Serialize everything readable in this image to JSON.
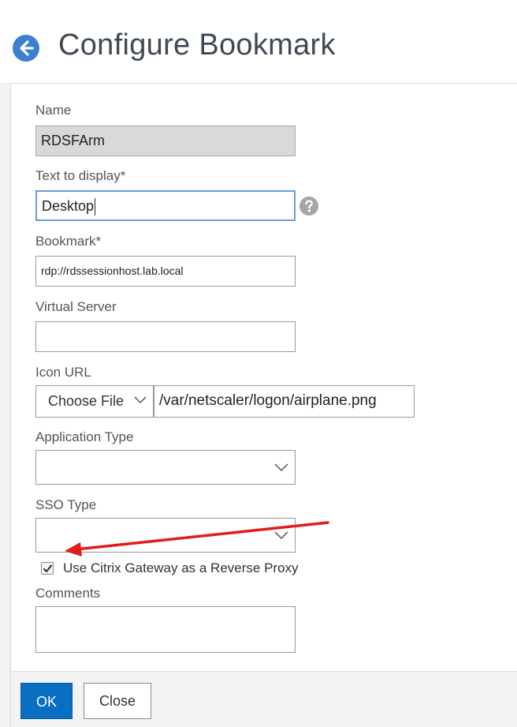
{
  "page": {
    "title": "Configure Bookmark"
  },
  "form": {
    "name": {
      "label": "Name",
      "value": "RDSFArm"
    },
    "text_to_display": {
      "label": "Text to display*",
      "value": "Desktop"
    },
    "bookmark": {
      "label": "Bookmark*",
      "value": "rdp://rdssessionhost.lab.local"
    },
    "virtual_server": {
      "label": "Virtual Server",
      "value": ""
    },
    "icon_url": {
      "label": "Icon URL",
      "choose_file_label": "Choose File",
      "value": "/var/netscaler/logon/airplane.png"
    },
    "application_type": {
      "label": "Application Type",
      "value": ""
    },
    "sso_type": {
      "label": "SSO Type",
      "value": ""
    },
    "reverse_proxy": {
      "label": "Use Citrix Gateway as a Reverse Proxy",
      "checked": true
    },
    "comments": {
      "label": "Comments",
      "value": ""
    }
  },
  "footer": {
    "ok_label": "OK",
    "close_label": "Close"
  },
  "colors": {
    "accent": "#0a6fc2",
    "annotation_arrow": "#e21b1b",
    "back_icon": "#3a7fd0"
  },
  "icons": [
    "back-arrow-icon",
    "help-icon",
    "chevron-down-icon",
    "checkmark-icon"
  ]
}
